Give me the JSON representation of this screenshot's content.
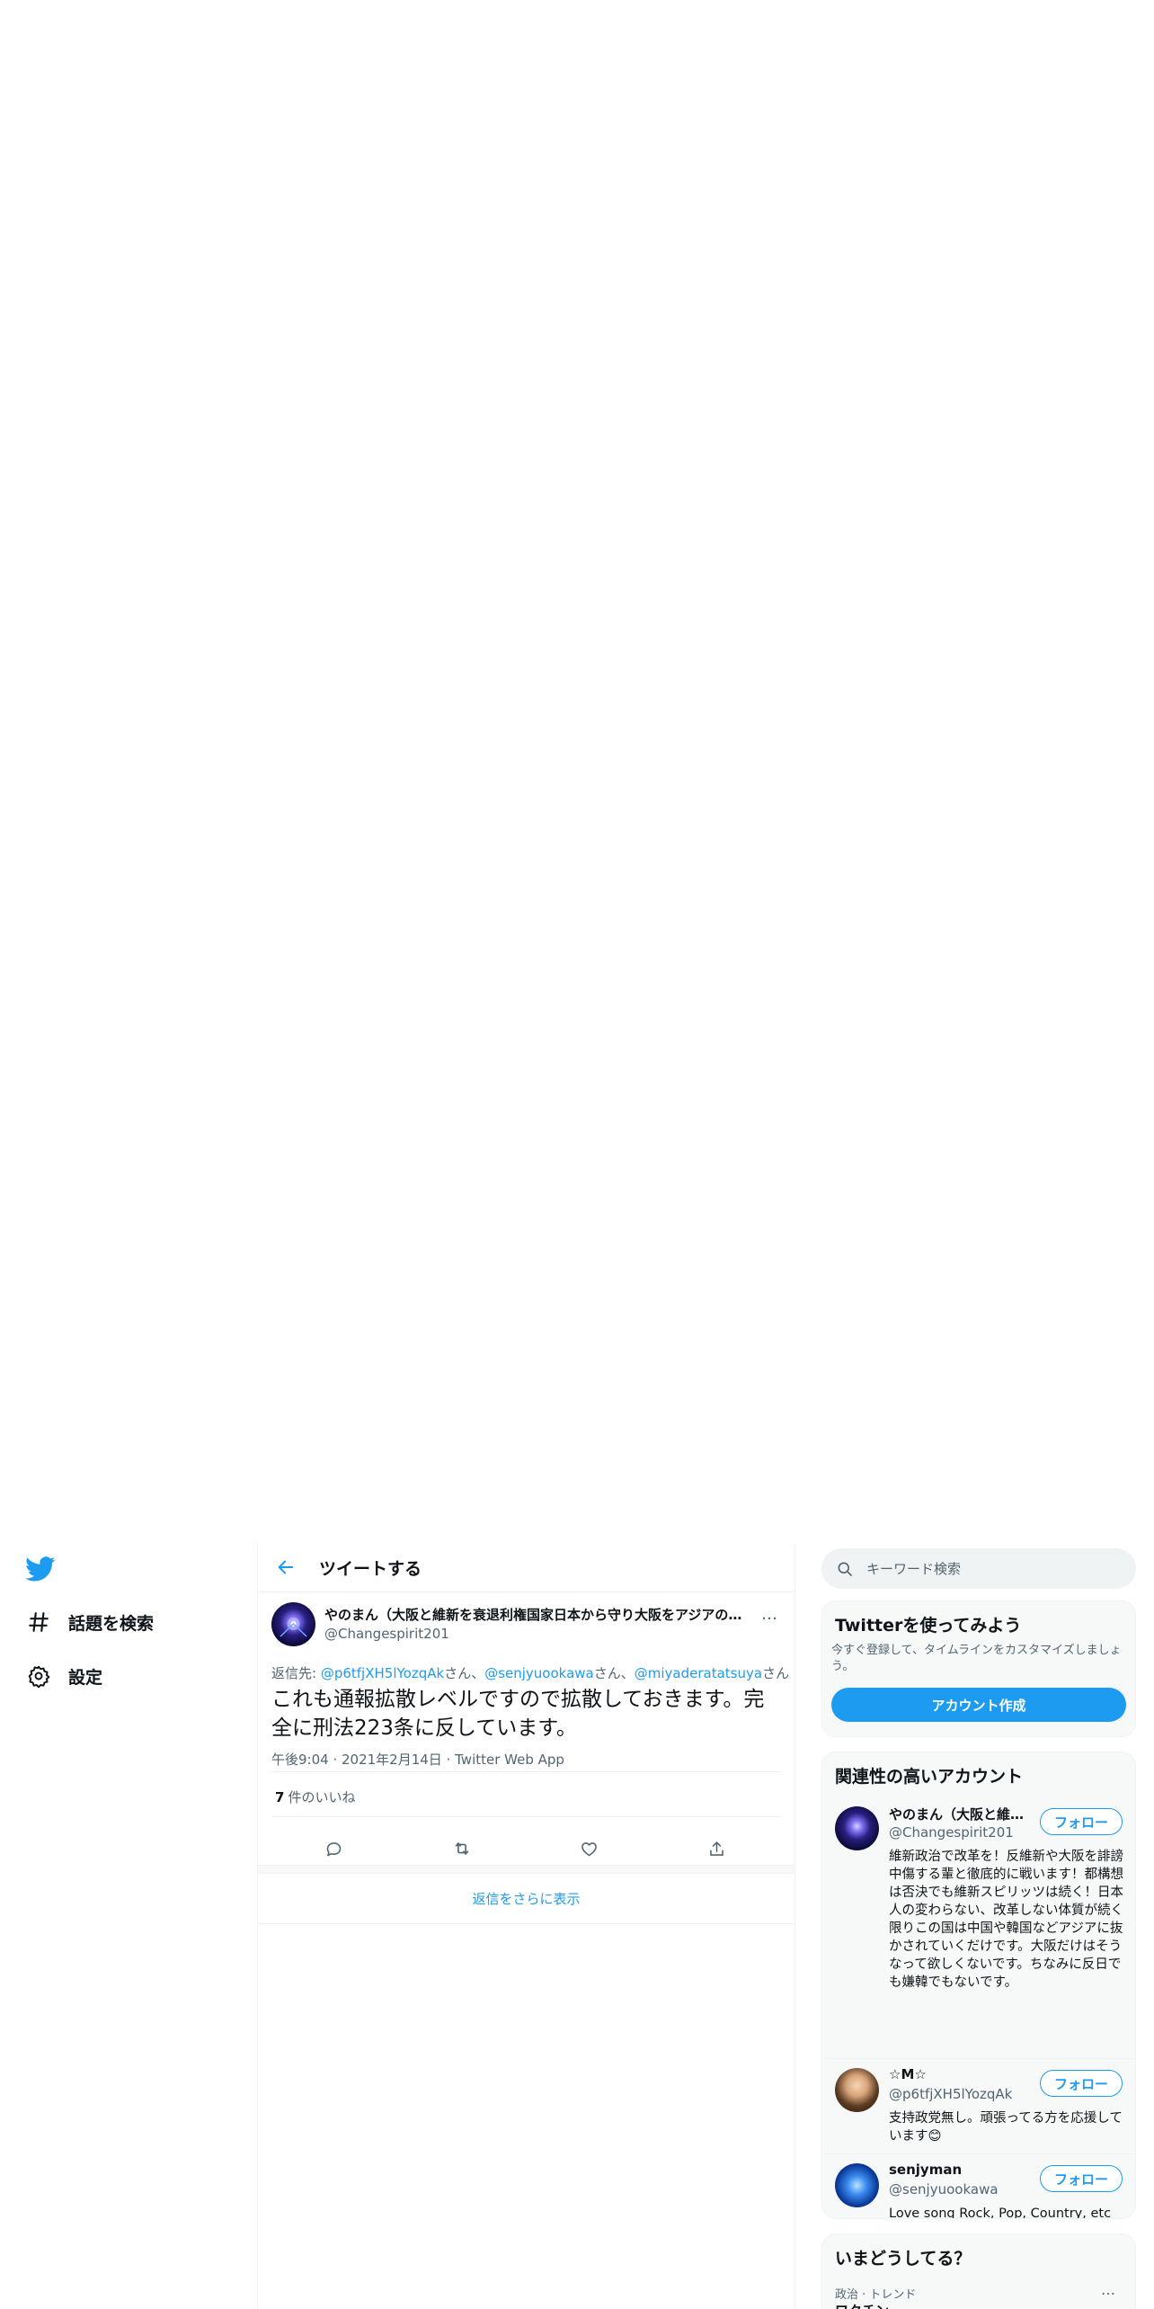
{
  "nav": {
    "explore_label": "話題を検索",
    "settings_label": "設定"
  },
  "header": {
    "title": "ツイートする"
  },
  "tweet": {
    "author_name": "やのまん（大阪と維新を衰退利権国家日本から守り大阪をアジアの…",
    "author_handle": "@Changespirit201",
    "reply_prefix": "返信先: ",
    "reply_to": [
      {
        "handle": "@p6tfjXH5lYozqAk",
        "suffix": "さん、"
      },
      {
        "handle": "@senjyuookawa",
        "suffix": "さん、"
      },
      {
        "handle": "@miyaderatatsuya",
        "suffix": "さん"
      }
    ],
    "text": "これも通報拡散レベルですので拡散しておきます。完全に刑法223条に反しています。",
    "time": "午後9:04",
    "date": "2021年2月14日",
    "client": "Twitter Web App",
    "likes_count": "7",
    "likes_label": "件のいいね",
    "more_icon": "…"
  },
  "show_more_replies": "返信をさらに表示",
  "search": {
    "placeholder": "キーワード検索"
  },
  "signup": {
    "title": "Twitterを使ってみよう",
    "description": "今すぐ登録して、タイムラインをカスタマイズしましょう。",
    "button": "アカウント作成"
  },
  "relevant": {
    "title": "関連性の高いアカウント",
    "follow_label": "フォロー",
    "accounts": [
      {
        "name": "やのまん（大阪と維…",
        "handle": "@Changespirit201",
        "bio": "維新政治で改革を！反維新や大阪を誹謗中傷する輩と徹底的に戦います！都構想は否決でも維新スピリッツは続く！日本人の変わらない、改革しない体質が続く限りこの国は中国や韓国などアジアに抜かされていくだけです。大阪だけはそうなって欲しくないです。ちなみに反日でも嫌韓でもないです。"
      },
      {
        "name": "☆M☆",
        "handle": "@p6tfjXH5lYozqAk",
        "bio": "支持政党無し。頑張ってる方を応援しています😊"
      },
      {
        "name": "senjyman",
        "handle": "@senjyuookawa",
        "bio": "Love song Rock, Pop, Country, etc and make cooking cake. Chris Mann, Terry McDermott and Lotus Crush, etc"
      }
    ]
  },
  "trends": {
    "title": "いまどうしてる？",
    "category": "政治 · トレンド",
    "more_icon": "…",
    "name": "ワクチン"
  },
  "colors": {
    "accent": "#1d9bf0",
    "text": "#0f1419",
    "secondary": "#536471",
    "border": "#eff3f4"
  }
}
